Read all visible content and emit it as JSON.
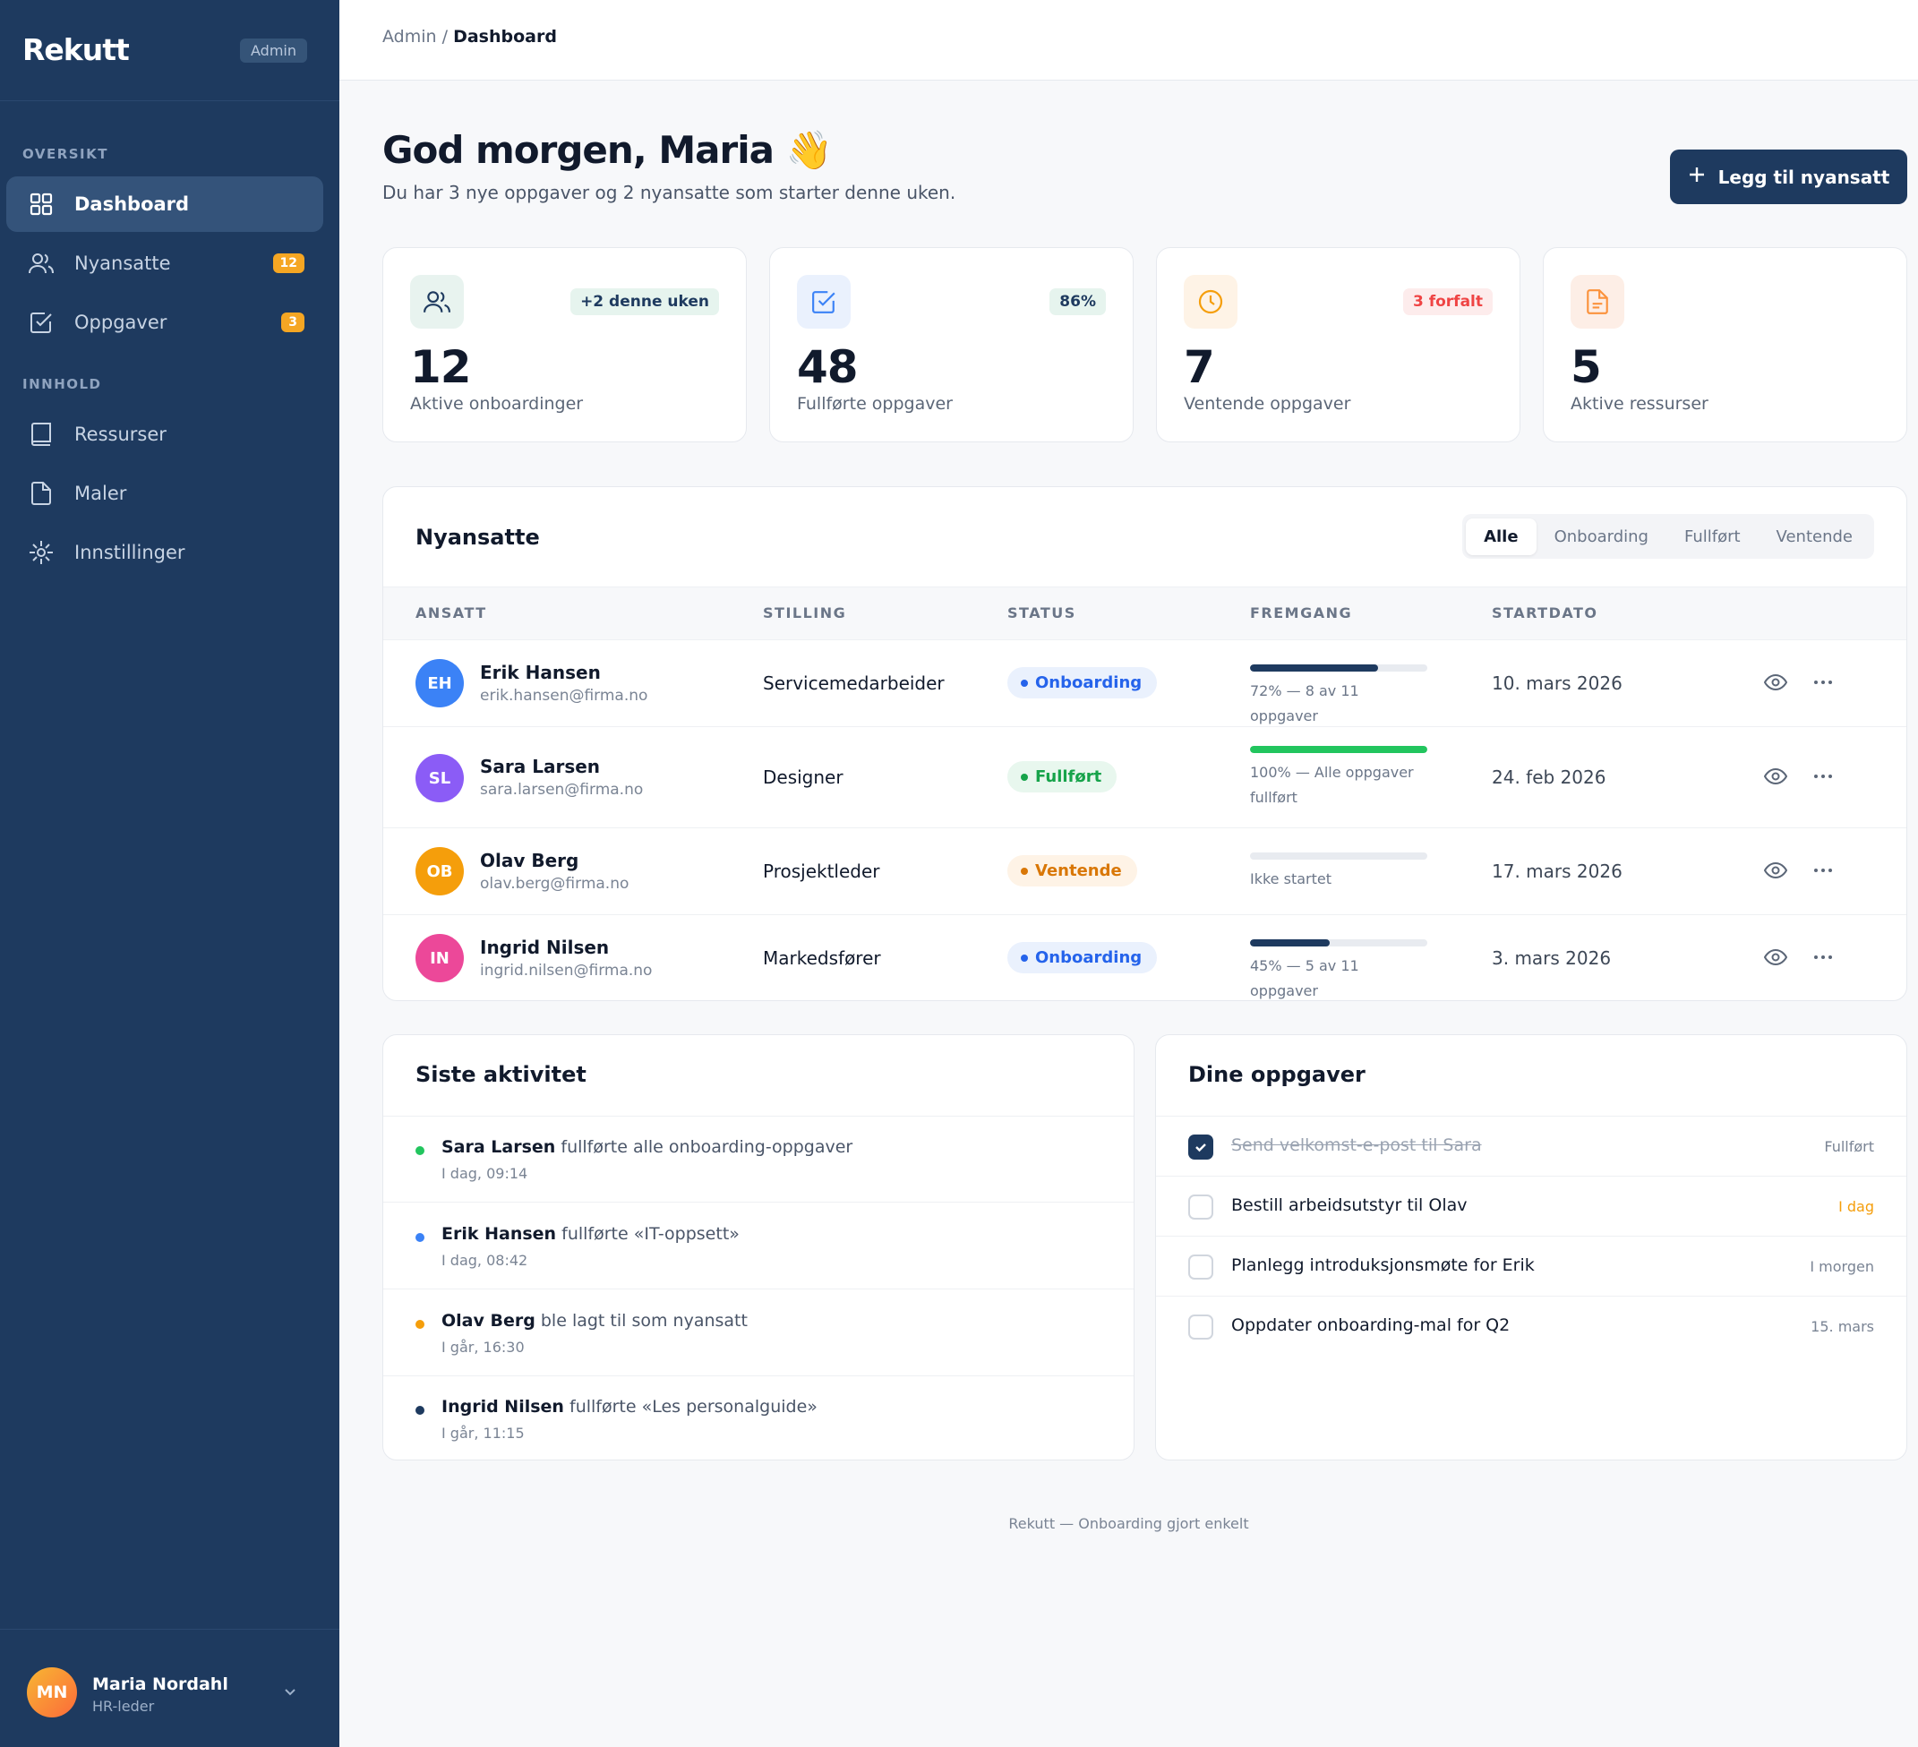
{
  "app": {
    "name": "Rekutt",
    "role_badge": "Admin"
  },
  "sidebar": {
    "sections": [
      {
        "label": "OVERSIKT"
      },
      {
        "label": "INNHOLD"
      }
    ],
    "items": [
      {
        "label": "Dashboard",
        "icon": "grid-icon",
        "active": true
      },
      {
        "label": "Nyansatte",
        "icon": "users-icon",
        "count": "12"
      },
      {
        "label": "Oppgaver",
        "icon": "checkbox-icon",
        "count": "3"
      },
      {
        "label": "Ressurser",
        "icon": "book-icon"
      },
      {
        "label": "Maler",
        "icon": "file-icon"
      },
      {
        "label": "Innstillinger",
        "icon": "settings-icon"
      }
    ],
    "user": {
      "initials": "MN",
      "name": "Maria Nordahl",
      "role": "HR-leder"
    }
  },
  "breadcrumb": {
    "parent": "Admin",
    "separator": "/",
    "current": "Dashboard"
  },
  "header": {
    "greeting": "God morgen, Maria",
    "emoji": "👋",
    "subtitle": "Du har 3 nye oppgaver og 2 nyansatte som starter denne uken.",
    "add_button": "Legg til nyansatt"
  },
  "stats": [
    {
      "value": "12",
      "label": "Aktive onboardinger",
      "badge": "+2 denne uken",
      "icon": "users-icon"
    },
    {
      "value": "48",
      "label": "Fullførte oppgaver",
      "badge": "86%",
      "icon": "checkbox-icon"
    },
    {
      "value": "7",
      "label": "Ventende oppgaver",
      "badge": "3 forfalt",
      "icon": "clock-icon"
    },
    {
      "value": "5",
      "label": "Aktive ressurser",
      "badge": "",
      "icon": "file-icon"
    }
  ],
  "employees": {
    "title": "Nyansatte",
    "tabs": [
      "Alle",
      "Onboarding",
      "Fullført",
      "Ventende"
    ],
    "active_tab": "Alle",
    "columns": [
      "ANSATT",
      "STILLING",
      "STATUS",
      "FREMGANG",
      "STARTDATO"
    ],
    "rows": [
      {
        "initials": "EH",
        "name": "Erik Hansen",
        "email": "erik.hansen@firma.no",
        "position": "Servicemedarbeider",
        "status": "Onboarding",
        "progress": 0.72,
        "progress_text": "72% — 8 av 11 oppgaver",
        "start": "10. mars 2026",
        "color": "#3b82f6"
      },
      {
        "initials": "SL",
        "name": "Sara Larsen",
        "email": "sara.larsen@firma.no",
        "position": "Designer",
        "status": "Fullført",
        "progress": 1.0,
        "progress_text": "100% — Alle oppgaver fullført",
        "start": "24. feb 2026",
        "color": "#8b5cf6"
      },
      {
        "initials": "OB",
        "name": "Olav Berg",
        "email": "olav.berg@firma.no",
        "position": "Prosjektleder",
        "status": "Ventende",
        "progress": 0.0,
        "progress_text": "Ikke startet",
        "start": "17. mars 2026",
        "color": "#f59e0b"
      },
      {
        "initials": "IN",
        "name": "Ingrid Nilsen",
        "email": "ingrid.nilsen@firma.no",
        "position": "Markedsfører",
        "status": "Onboarding",
        "progress": 0.45,
        "progress_text": "45% — 5 av 11 oppgaver",
        "start": "3. mars 2026",
        "color": "#ec4899"
      }
    ]
  },
  "activity": {
    "title": "Siste aktivitet",
    "items": [
      {
        "name": "Sara Larsen",
        "text": "fullførte alle onboarding-oppgaver",
        "time": "I dag, 09:14",
        "color": "#22c55e"
      },
      {
        "name": "Erik Hansen",
        "text": "fullførte «IT-oppsett»",
        "time": "I dag, 08:42",
        "color": "#3b82f6"
      },
      {
        "name": "Olav Berg",
        "text": "ble lagt til som nyansatt",
        "time": "I går, 16:30",
        "color": "#f59e0b"
      },
      {
        "name": "Ingrid Nilsen",
        "text": "fullførte «Les personalguide»",
        "time": "I går, 11:15",
        "color": "#1e3a5f"
      }
    ]
  },
  "tasks": {
    "title": "Dine oppgaver",
    "items": [
      {
        "text": "Send velkomst-e-post til Sara",
        "due": "Fullført",
        "done": true
      },
      {
        "text": "Bestill arbeidsutstyr til Olav",
        "due": "I dag",
        "done": false,
        "urgent": true
      },
      {
        "text": "Planlegg introduksjonsmøte for Erik",
        "due": "I morgen",
        "done": false
      },
      {
        "text": "Oppdater onboarding-mal for Q2",
        "due": "15. mars",
        "done": false
      }
    ]
  },
  "footer": "Rekutt — Onboarding gjort enkelt",
  "colors": {
    "primary": "#1e3a5f",
    "accent": "#f5a623",
    "success": "#22c55e",
    "info": "#3b82f6",
    "warning": "#f59e0b",
    "danger": "#ef4444"
  }
}
